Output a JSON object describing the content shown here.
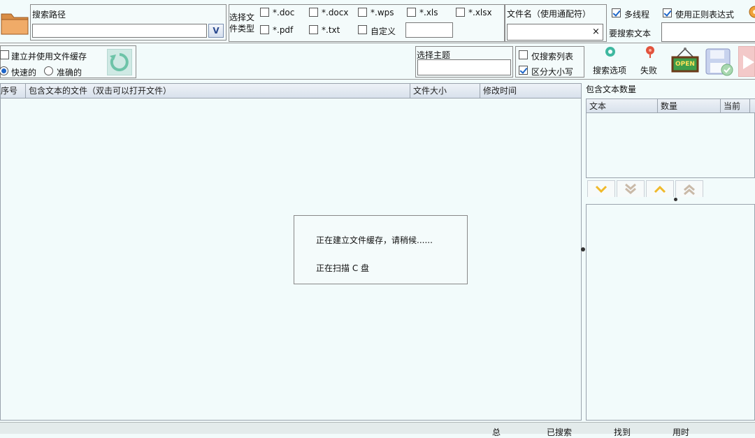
{
  "toolbar": {
    "search_path_label": "搜索路径",
    "search_path_value": "",
    "dropdown_glyph": "V",
    "file_type_label": "选择文件类型",
    "file_types": [
      {
        "label": "*.doc",
        "checked": false
      },
      {
        "label": "*.docx",
        "checked": false
      },
      {
        "label": "*.wps",
        "checked": false
      },
      {
        "label": "*.xls",
        "checked": false
      },
      {
        "label": "*.xlsx",
        "checked": false
      },
      {
        "label": "*.pdf",
        "checked": false
      },
      {
        "label": "*.txt",
        "checked": false
      },
      {
        "label": "自定义",
        "checked": false
      }
    ],
    "filename_label": "文件名（使用通配符）",
    "filename_value": "",
    "clear_glyph": "×",
    "multithread_label": "多线程",
    "multithread_checked": true,
    "regex_label": "使用正则表达式",
    "regex_checked": true,
    "search_text_label": "要搜索文本",
    "search_text_value": ""
  },
  "options": {
    "cache_label": "建立并使用文件缓存",
    "cache_checked": false,
    "fast_label": "快速的",
    "fast_selected": true,
    "accurate_label": "准确的",
    "accurate_selected": false,
    "theme_label": "选择主题",
    "theme_value": "",
    "list_only_label": "仅搜索列表",
    "list_only_checked": false,
    "case_label": "区分大小写",
    "case_checked": true,
    "search_options_label": "搜索选项",
    "fail_label": "失败",
    "open_sign_text": "OPEN"
  },
  "results_table": {
    "columns": [
      "序号",
      "包含文本的文件（双击可以打开文件）",
      "文件大小",
      "修改时间"
    ],
    "rows": []
  },
  "text_count": {
    "title": "包含文本数量",
    "columns": [
      "文本",
      "数量",
      "当前"
    ]
  },
  "progress_dialog": {
    "line1": "正在建立文件缓存，请稍候......",
    "line2": "正在扫描 C 盘"
  },
  "status_bar": {
    "total": "总",
    "searched": "已搜索",
    "found": "找到",
    "time": "用时"
  },
  "colors": {
    "accent": "#1e66c8",
    "background": "#f2fbfb",
    "folder": "#e8a15c"
  }
}
